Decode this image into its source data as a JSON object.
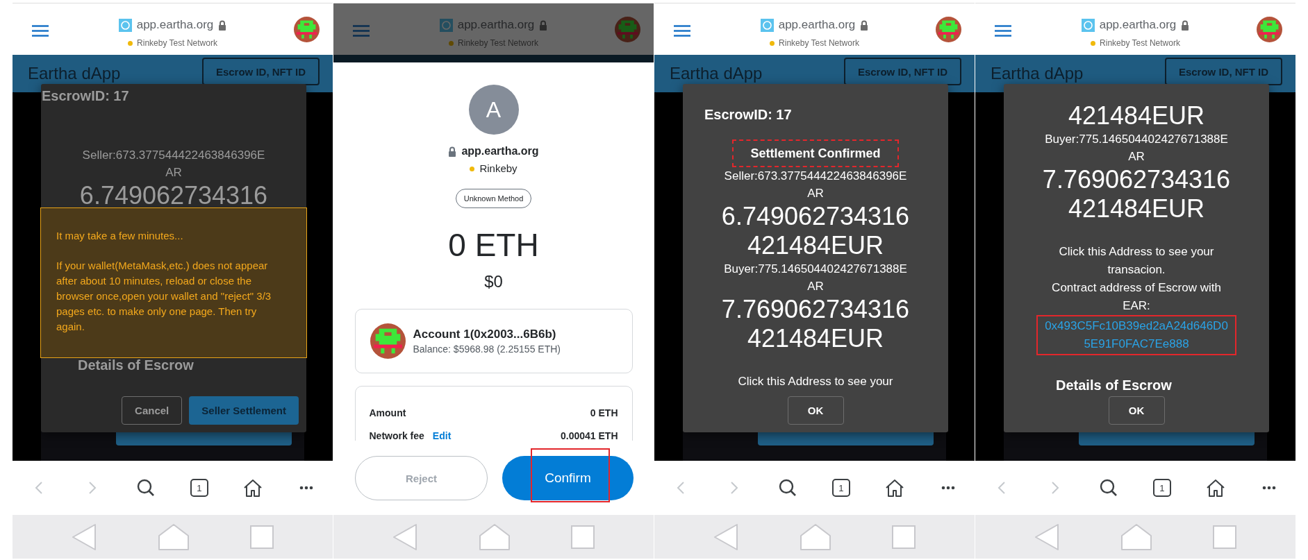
{
  "panels": [
    {
      "kind": "dapp",
      "browser": {
        "url": "app.eartha.org",
        "network": "Rinkeby Test Network",
        "dimmed": false
      },
      "app_bar": {
        "title": "Eartha dApp",
        "button": "Escrow ID, NFT ID"
      },
      "dialog": {
        "dimmed": true,
        "items": [
          {
            "kind": "heading",
            "text": "EscrowID: 17"
          },
          {
            "kind": "small",
            "text": "Seller:673.377544422463846396EAR"
          },
          {
            "kind": "big",
            "text": "6.749062734316"
          },
          {
            "kind": "section",
            "text": "Details of Escrow"
          }
        ],
        "buttons": [
          {
            "label": "Cancel",
            "kind": "outline"
          },
          {
            "label": "Seller Settlement",
            "kind": "primary"
          }
        ]
      },
      "notice": {
        "title": "It may take a few minutes...",
        "text": "If your wallet(MetaMask,etc.) does not appear after about 10 minutes, reload or close the browser once,open your wallet and \"reject\" 3/3 pages etc. to make only one page. Then try again."
      },
      "toolbar": {
        "back_disabled": true,
        "forward_disabled": true,
        "tab_count": "1"
      }
    },
    {
      "kind": "wallet",
      "browser": {
        "url": "app.eartha.org",
        "network": "Rinkeby Test Network",
        "dimmed": true
      },
      "wallet": {
        "avatar_letter": "A",
        "site": "app.eartha.org",
        "network": "Rinkeby",
        "method": "Unknown Method",
        "amount": "0 ETH",
        "fiat": "$0",
        "account": {
          "name": "Account 1(0x2003...6B6b)",
          "balance": "Balance: $5968.98 (2.25155 ETH)"
        },
        "details": [
          {
            "label": "Amount",
            "value": "0 ETH"
          },
          {
            "label": "Network fee",
            "link": "Edit",
            "value": "0.00041 ETH"
          }
        ],
        "buttons": [
          {
            "label": "Reject",
            "kind": "secondary",
            "highlighted": false
          },
          {
            "label": "Confirm",
            "kind": "primary",
            "highlighted": true
          }
        ]
      }
    },
    {
      "kind": "dapp",
      "browser": {
        "url": "app.eartha.org",
        "network": "Rinkeby Test Network",
        "dimmed": false
      },
      "app_bar": {
        "title": "Eartha dApp",
        "button": "Escrow ID, NFT ID"
      },
      "dialog": {
        "dimmed": false,
        "items": [
          {
            "kind": "heading",
            "text": "EscrowID: 17"
          },
          {
            "kind": "status",
            "text": "Settlement Confirmed",
            "highlighted": true
          },
          {
            "kind": "small",
            "text": "Seller:673.377544422463846396EAR"
          },
          {
            "kind": "big",
            "text": "6.749062734316421484EUR"
          },
          {
            "kind": "small",
            "text": "Buyer:775.146504402427671388EAR"
          },
          {
            "kind": "big",
            "text": "7.769062734316421484EUR"
          },
          {
            "kind": "note",
            "text": "Click this Address to see your"
          }
        ],
        "buttons": [
          {
            "label": "OK",
            "kind": "outline"
          }
        ]
      },
      "toolbar": {
        "back_disabled": true,
        "forward_disabled": true,
        "tab_count": "1"
      }
    },
    {
      "kind": "dapp",
      "browser": {
        "url": "app.eartha.org",
        "network": "Rinkeby Test Network",
        "dimmed": false
      },
      "app_bar": {
        "title": "Eartha dApp",
        "button": "Escrow ID, NFT ID"
      },
      "dialog": {
        "dimmed": false,
        "items": [
          {
            "kind": "big",
            "text": "421484EUR"
          },
          {
            "kind": "small",
            "text": "Buyer:775.146504402427671388EAR"
          },
          {
            "kind": "big",
            "text": "7.769062734316421484EUR"
          },
          {
            "kind": "note",
            "text": "Click this Address to see your transacion."
          },
          {
            "kind": "note",
            "text": "Contract address of Escrow with EAR:"
          },
          {
            "kind": "link",
            "text": "0x493C5Fc10B39ed2aA24d646D05E91F0FAC7Ee888",
            "highlighted": true
          },
          {
            "kind": "section",
            "text": "Details of Escrow"
          }
        ],
        "buttons": [
          {
            "label": "OK",
            "kind": "outline"
          }
        ]
      },
      "toolbar": {
        "back_disabled": true,
        "forward_disabled": true,
        "tab_count": "1"
      }
    }
  ]
}
